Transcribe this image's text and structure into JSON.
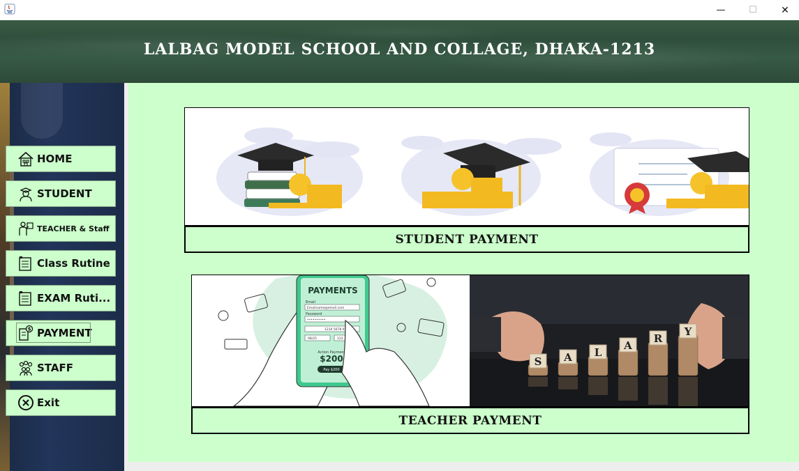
{
  "window": {
    "minimize_glyph": "—",
    "maximize_glyph": "☐",
    "close_glyph": "✕"
  },
  "header": {
    "title": "LALBAG MODEL SCHOOL AND COLLAGE, DHAKA-1213"
  },
  "sidebar": {
    "items": [
      {
        "label": "HOME",
        "icon": "home-icon"
      },
      {
        "label": "STUDENT",
        "icon": "student-icon"
      },
      {
        "label": "TEACHER & Staff",
        "icon": "teacher-icon"
      },
      {
        "label": "Class Rutine",
        "icon": "routine-icon"
      },
      {
        "label": "EXAM Ruti...",
        "icon": "exam-routine-icon"
      },
      {
        "label": "PAYMENT",
        "icon": "payment-icon"
      },
      {
        "label": "STAFF",
        "icon": "staff-icon"
      },
      {
        "label": "Exit",
        "icon": "exit-icon"
      }
    ]
  },
  "main": {
    "student_payment_label": "STUDENT PAYMENT",
    "teacher_payment_label": "TEACHER PAYMENT",
    "phone": {
      "title": "PAYMENTS",
      "email_label": "Email",
      "email_value": "Emailname@email.com",
      "password_label": "Password",
      "password_value": "••••••••••",
      "card_number": "1234 5678 9101",
      "expiry": "08/25",
      "cvc": "123",
      "action_label": "Action Payment",
      "amount": "$200",
      "pay_button": "Pay $200"
    },
    "salary_letters": [
      "S",
      "A",
      "L",
      "A",
      "R",
      "Y"
    ]
  },
  "colors": {
    "content_bg": "#ccffcc",
    "button_bg": "#ccffcc",
    "header_green": "#2f4f3c",
    "sidebar_navy": "#1c2c4a"
  }
}
